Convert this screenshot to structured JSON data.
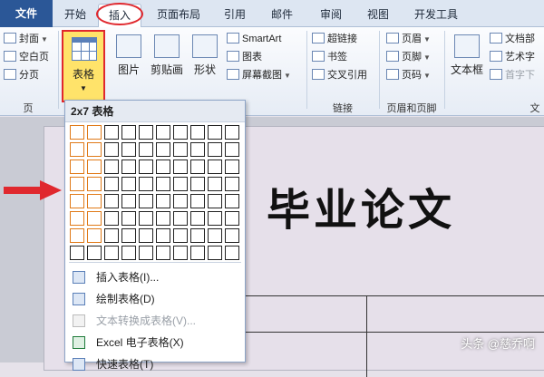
{
  "tabs": [
    "文件",
    "开始",
    "插入",
    "页面布局",
    "引用",
    "邮件",
    "审阅",
    "视图",
    "开发工具"
  ],
  "ribbon": {
    "pages_group": {
      "items": [
        "封面",
        "空白页",
        "分页"
      ],
      "label": "页"
    },
    "table_button": "表格",
    "illustrations": {
      "picture": "图片",
      "clipart": "剪贴画",
      "shapes": "形状",
      "smartart": "SmartArt",
      "chart": "图表",
      "screenshot": "屏幕截图"
    },
    "links_group": {
      "items": [
        "超链接",
        "书签",
        "交叉引用"
      ],
      "label": "链接"
    },
    "header_footer_group": {
      "items": [
        "页眉",
        "页脚",
        "页码"
      ],
      "label": "页眉和页脚"
    },
    "text_group": {
      "textbox": "文本框",
      "items": [
        "文档部",
        "艺术字",
        "首字下"
      ],
      "label": "文"
    }
  },
  "document": {
    "title": "毕业论文"
  },
  "table_dropdown": {
    "title": "2x7 表格",
    "grid": {
      "columns": 10,
      "rows": 8,
      "highlight_columns": 2,
      "highlight_rows": 7
    },
    "menu": [
      {
        "label": "插入表格(I)...",
        "disabled": false
      },
      {
        "label": "绘制表格(D)",
        "disabled": false
      },
      {
        "label": "文本转换成表格(V)...",
        "disabled": true
      },
      {
        "label": "Excel 电子表格(X)",
        "disabled": false
      },
      {
        "label": "快速表格(T)",
        "disabled": false
      }
    ]
  },
  "colors": {
    "highlight": "#ffe36a",
    "annotation": "#e0282e",
    "grid_highlight": "#e07a18"
  },
  "watermark": "头条 @慈乔啊"
}
